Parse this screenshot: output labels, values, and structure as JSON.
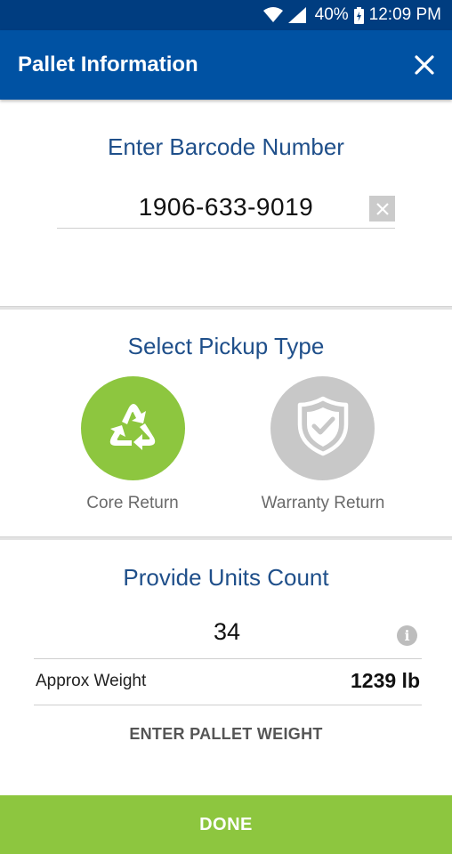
{
  "status_bar": {
    "wifi_icon": "wifi-icon",
    "signal_icon": "signal-icon",
    "battery_percent": "40%",
    "battery_icon": "battery-charging-icon",
    "time": "12:09 PM"
  },
  "app_bar": {
    "title": "Pallet Information",
    "close_icon": "close-icon",
    "background": "#0052a3"
  },
  "barcode": {
    "heading": "Enter Barcode Number",
    "value": "1906-633-9019",
    "clear_icon": "clear-icon"
  },
  "pickup": {
    "heading": "Select Pickup Type",
    "options": [
      {
        "label": "Core Return",
        "icon": "recycle-icon",
        "color": "#8dc63f",
        "selected": true
      },
      {
        "label": "Warranty Return",
        "icon": "shield-check-icon",
        "color": "#c8c8c8",
        "selected": false
      }
    ]
  },
  "units": {
    "heading": "Provide Units Count",
    "value": "34",
    "info_icon": "info-icon",
    "info_glyph": "i",
    "weight_label": "Approx Weight",
    "weight_value": "1239 lb",
    "enter_weight_label": "ENTER PALLET WEIGHT"
  },
  "footer": {
    "done_label": "DONE",
    "color": "#8dc63f"
  }
}
